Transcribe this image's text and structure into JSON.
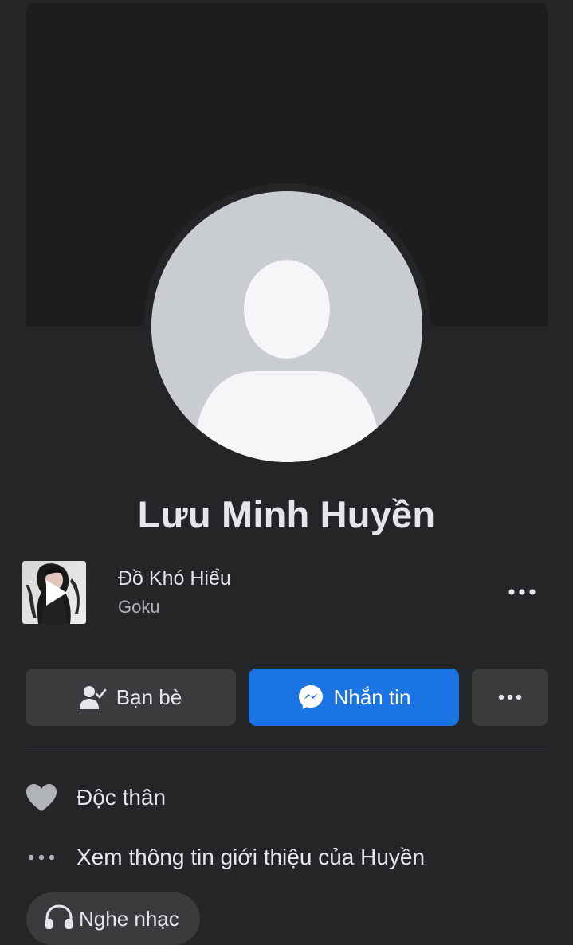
{
  "profile": {
    "name": "Lưu Minh Huyền"
  },
  "music": {
    "title": "Đồ Khó Hiểu",
    "artist": "Goku"
  },
  "actions": {
    "friends_label": "Bạn bè",
    "message_label": "Nhắn tin"
  },
  "intro": {
    "relationship": "Độc thân",
    "see_about": "Xem thông tin giới thiệu của Huyền",
    "music_chip": "Nghe nhạc"
  },
  "icons": {
    "friends": "person-check-icon",
    "messenger": "messenger-icon",
    "more": "more-dots-icon",
    "relationship": "heart-icon",
    "about": "more-dots-icon",
    "music_chip": "headphones-icon",
    "play": "play-icon"
  },
  "colors": {
    "background": "#242526",
    "cover": "#1c1d1f",
    "button_secondary": "#3a3b3c",
    "accent_blue": "#1b74e4",
    "avatar_placeholder": "#c9ccd1"
  }
}
